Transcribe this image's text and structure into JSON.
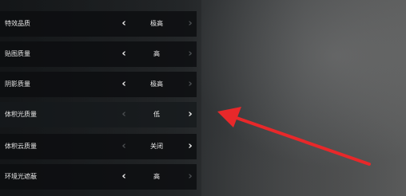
{
  "settings": {
    "rows": [
      {
        "label": "特效品质",
        "value": "极高"
      },
      {
        "label": "贴图质量",
        "value": "高"
      },
      {
        "label": "阴影质量",
        "value": "极高"
      },
      {
        "label": "体积光质量",
        "value": "低"
      },
      {
        "label": "体积云质量",
        "value": "关闭"
      },
      {
        "label": "环境光遮蔽",
        "value": "高"
      }
    ]
  },
  "icons": {
    "left": "‹",
    "right": "›",
    "left_icon": "chevron-left-icon",
    "right_icon": "chevron-right-icon"
  },
  "annotation": {
    "type": "red-arrow-pointer",
    "color": "#e8282a",
    "points_to": "体积光质量"
  }
}
